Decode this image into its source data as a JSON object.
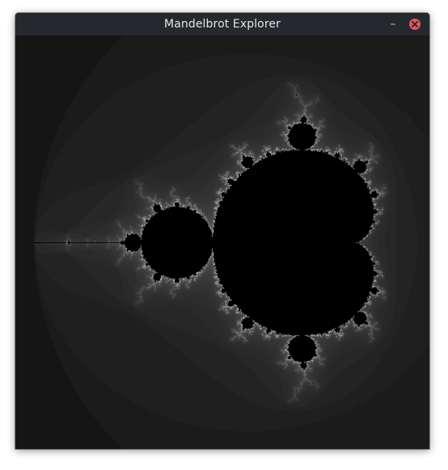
{
  "window": {
    "title": "Mandelbrot Explorer",
    "minimize_icon": "minimize-icon",
    "close_icon": "close-icon",
    "minimize_glyph": "–"
  },
  "view": {
    "fractal": "mandelbrot",
    "palette": "grayscale",
    "background_color": "#080808",
    "set_color": "#000000",
    "accent_close_color": "#e25660"
  }
}
